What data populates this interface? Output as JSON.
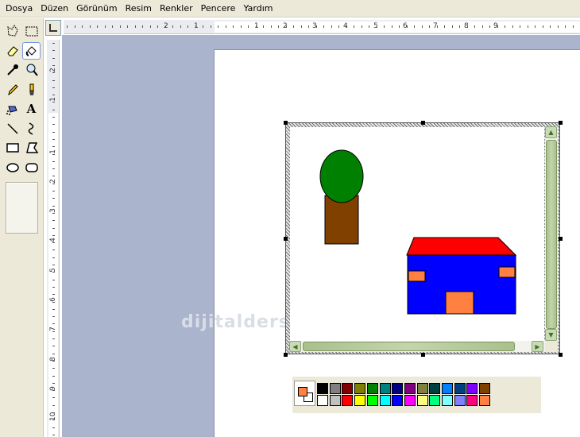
{
  "menu": [
    "Dosya",
    "Düzen",
    "Görünüm",
    "Resim",
    "Renkler",
    "Pencere",
    "Yardım"
  ],
  "tools": [
    {
      "name": "free-form-select-tool"
    },
    {
      "name": "rectangle-select-tool"
    },
    {
      "name": "eraser-tool"
    },
    {
      "name": "fill-with-color-tool",
      "active": true
    },
    {
      "name": "pick-color-tool"
    },
    {
      "name": "magnifier-tool"
    },
    {
      "name": "pencil-tool"
    },
    {
      "name": "brush-tool"
    },
    {
      "name": "airbrush-tool"
    },
    {
      "name": "text-tool",
      "glyph": "A"
    },
    {
      "name": "line-tool"
    },
    {
      "name": "curve-tool"
    },
    {
      "name": "rectangle-tool"
    },
    {
      "name": "polygon-tool"
    },
    {
      "name": "ellipse-tool"
    },
    {
      "name": "rounded-rectangle-tool"
    }
  ],
  "h_ruler_numbers": [
    "2",
    "1",
    "1",
    "2",
    "3",
    "4",
    "5",
    "6",
    "7",
    "8",
    "9"
  ],
  "v_ruler_numbers": [
    "2",
    "1",
    "1",
    "2",
    "3",
    "4",
    "5",
    "6",
    "7",
    "8",
    "9",
    "10"
  ],
  "watermark": "dijitalders.com",
  "colors": {
    "tree_top": "#008000",
    "tree_trunk": "#804000",
    "roof": "#ff0000",
    "house_wall": "#0000ff",
    "window_door": "#ff8040",
    "primary": "#ff8040",
    "secondary": "#ffffff"
  },
  "palette_top": [
    "#000000",
    "#808080",
    "#800000",
    "#808000",
    "#008000",
    "#008080",
    "#000080",
    "#800080",
    "#808040",
    "#004040",
    "#0080ff",
    "#004080",
    "#8000ff",
    "#804000"
  ],
  "palette_bottom": [
    "#ffffff",
    "#c0c0c0",
    "#ff0000",
    "#ffff00",
    "#00ff00",
    "#00ffff",
    "#0000ff",
    "#ff00ff",
    "#ffff80",
    "#00ff80",
    "#80ffff",
    "#8080ff",
    "#ff0080",
    "#ff8040"
  ]
}
